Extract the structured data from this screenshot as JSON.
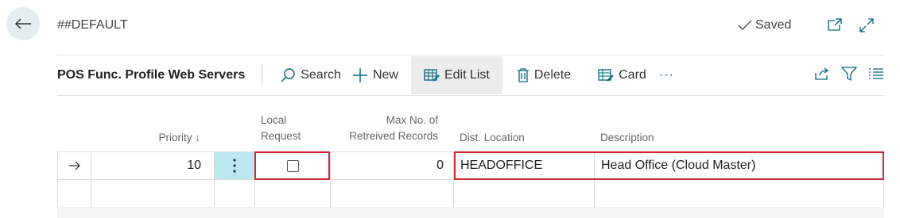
{
  "header": {
    "title": "##DEFAULT",
    "saved_label": "Saved"
  },
  "toolbar": {
    "page_name": "POS Func. Profile Web Servers",
    "search_label": "Search",
    "new_label": "New",
    "edit_list_label": "Edit List",
    "delete_label": "Delete",
    "card_label": "Card",
    "more_label": "···"
  },
  "columns": {
    "priority": "Priority ↓",
    "local_request_1": "Local",
    "local_request_2": "Request",
    "max_records_1": "Max No. of",
    "max_records_2": "Retreived Records",
    "dist_location": "Dist. Location",
    "description": "Description"
  },
  "rows": [
    {
      "priority": "10",
      "local_request": false,
      "max_records": "0",
      "dist_location": "HEADOFFICE",
      "description": "Head Office (Cloud Master)"
    }
  ],
  "colors": {
    "accent": "#00677e",
    "selected_cell": "#b9e8ef",
    "highlight_box": "#d22630"
  }
}
